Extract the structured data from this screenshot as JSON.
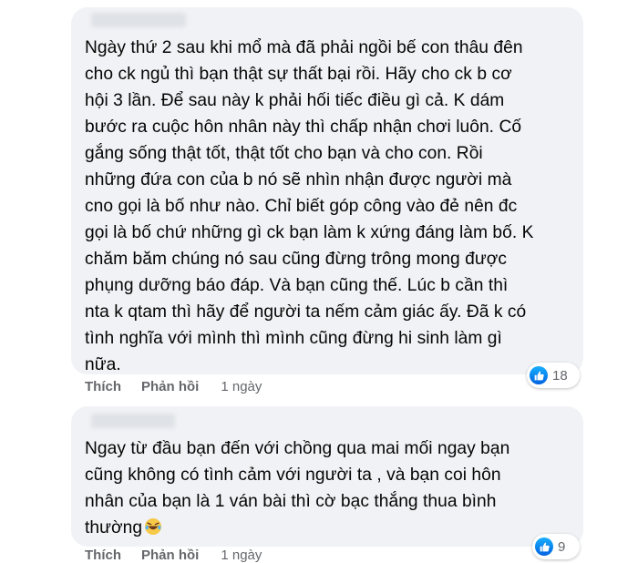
{
  "comments": [
    {
      "text": "Ngày thứ 2 sau khi mổ mà đã phải ngồi bế con thâu đên\ncho ck ngủ thì bạn thật sự thất bại rồi. Hãy cho ck b cơ\nhội 3 lần. Để sau này k phải hối tiếc điều gì cả. K dám\nbước ra cuộc hôn nhân này thì chấp nhận chơi luôn. Cố\ngắng sống thật tốt, thật tốt cho bạn và cho con. Rồi\nnhững đứa con của b nó sẽ nhìn nhận được người mà\ncno gọi là bố như nào. Chỉ biết góp công vào đẻ nên đc\ngọi là bố chứ những gì ck bạn làm k xứng đáng làm bố. K\nchăm băm chúng nó sau cũng đừng trông mong được\nphụng dưỡng báo đáp. Và bạn cũng thế. Lúc b cần thì\nnta k qtam thì hãy để người ta nếm cảm giác ấy. Đã k có\ntình nghĩa với mình thì mình cũng đừng hi sinh làm gì\nnữa.",
      "reaction_icon": "like-icon",
      "reaction_count": "18",
      "like_label": "Thích",
      "reply_label": "Phản hồi",
      "time": "1 ngày"
    },
    {
      "text": "Ngay từ đầu bạn đến với chồng qua mai mối ngay bạn\ncũng không có tình cảm với người ta , và bạn coi hôn\nnhân của bạn là 1 ván bài thì cờ bạc thắng thua bình\nthường",
      "emoji": "laughing-tears-emoji",
      "reaction_icon": "like-icon",
      "reaction_count": "9",
      "like_label": "Thích",
      "reply_label": "Phản hồi",
      "time": "1 ngày"
    }
  ],
  "colors": {
    "bubble": "#f0f2f5",
    "text": "#050505",
    "meta": "#65676b",
    "like_blue": "#1877f2"
  }
}
